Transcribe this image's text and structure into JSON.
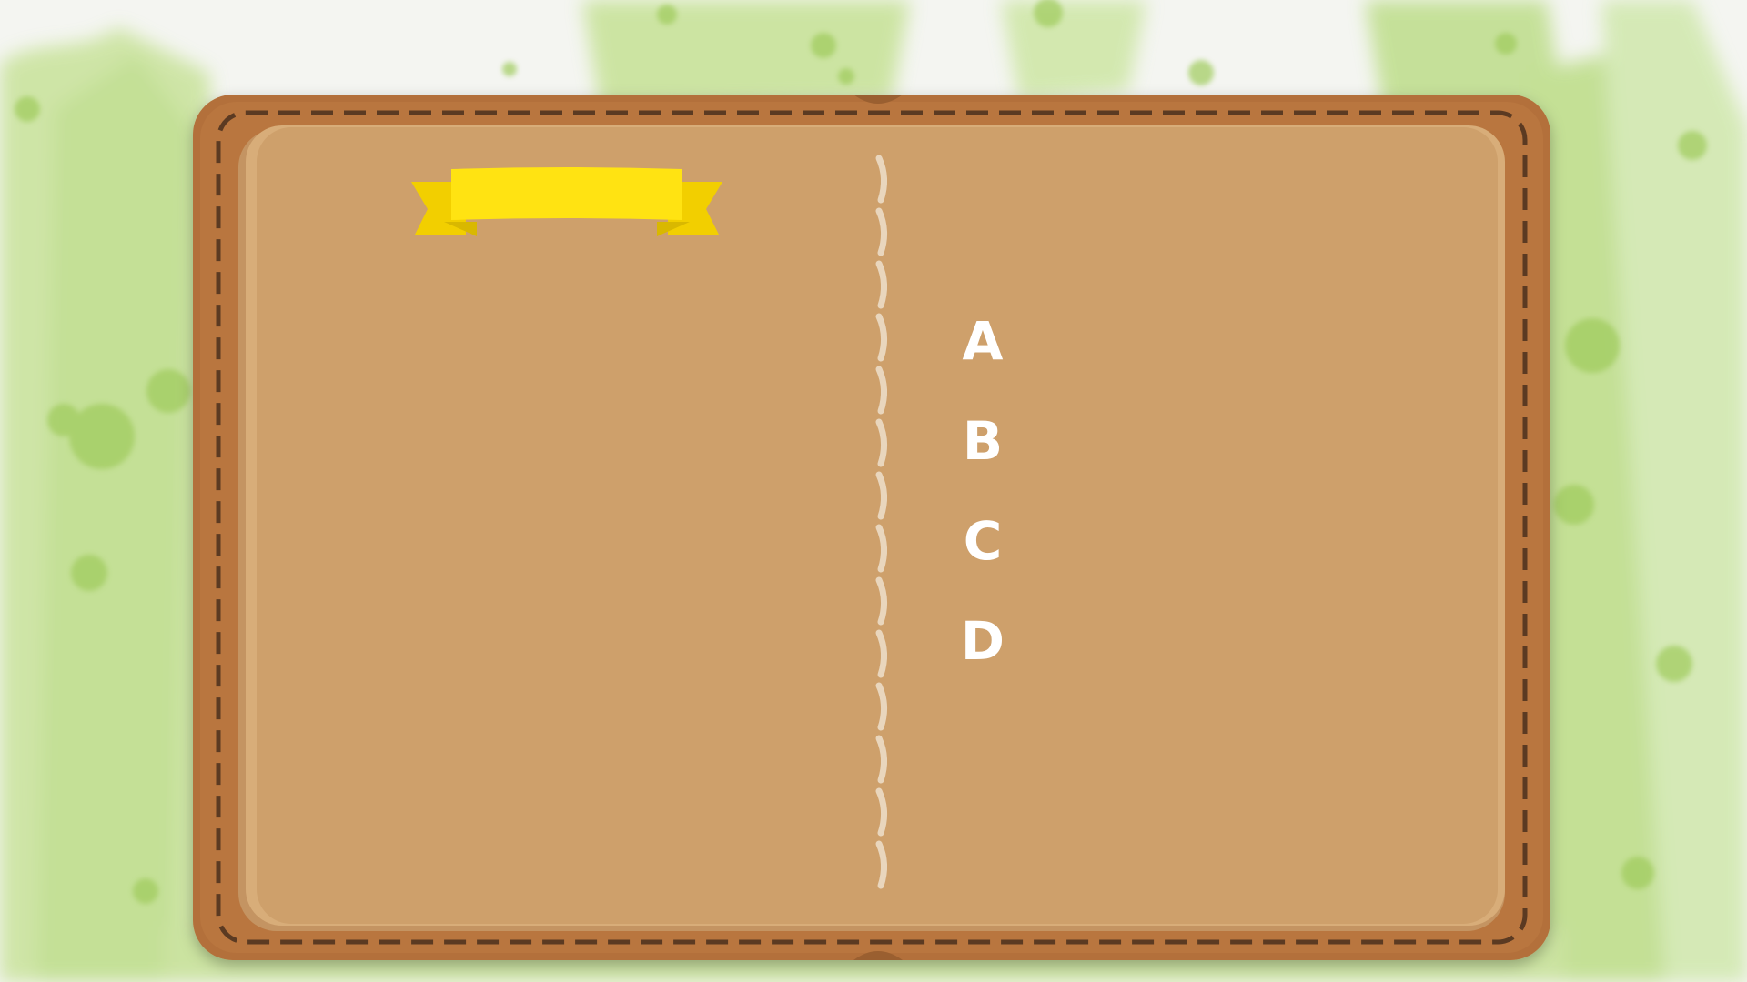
{
  "slide": {
    "ribbon_label": "",
    "options": [
      {
        "letter": "A",
        "text": ""
      },
      {
        "letter": "B",
        "text": ""
      },
      {
        "letter": "C",
        "text": ""
      },
      {
        "letter": "D",
        "text": ""
      }
    ]
  },
  "colors": {
    "background": "#f4f5f1",
    "watercolor_green": "#a9d36a",
    "leather": "#b3703a",
    "page": "#cea06b",
    "stitch_dark": "#5b3a22",
    "spine_stitch": "#e9d6bd",
    "ribbon": "#ffe312",
    "ribbon_fold": "#f2cf00",
    "option_text": "#ffffff"
  },
  "icons": [
    "notebook-illustration",
    "ribbon-banner"
  ]
}
